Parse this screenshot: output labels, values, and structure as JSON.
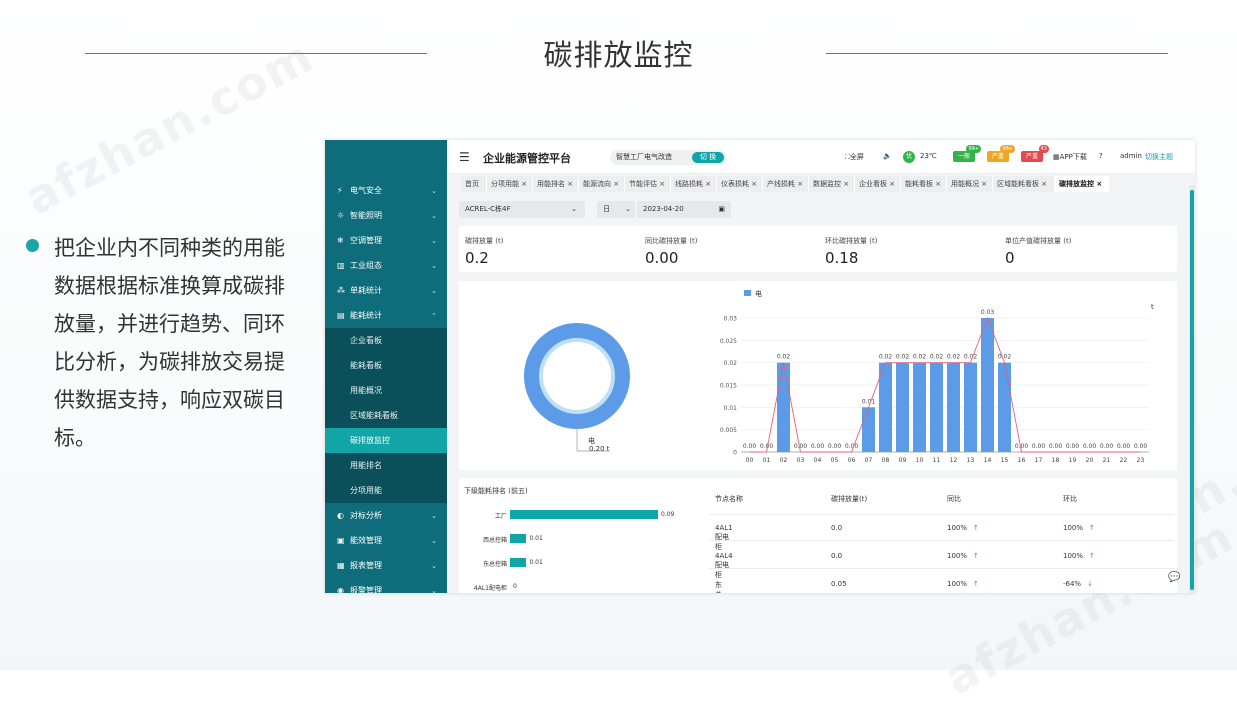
{
  "slide": {
    "title": "碳排放监控",
    "bullet": "把企业内不同种类的用能数据根据标准换算成碳排放量，并进行趋势、同环比分析，为碳排放交易提供数据支持，响应双碳目标。",
    "watermark": "afzhan.com",
    "accent": "#1aa6a6"
  },
  "app": {
    "title": "企业能源管控平台",
    "menu_icon": "hamburger-icon",
    "org_switch": {
      "label": "智慧工厂电气改造",
      "button": "切 换"
    },
    "topbar": {
      "fullscreen": "全屏",
      "weather": "23℃",
      "weather_badge": "优",
      "alert_general": "一般",
      "alert_general_count": "99+",
      "alert_severe": "严重",
      "alert_severe_count": "99+",
      "alert_critical": "严重",
      "alert_critical_count": "43",
      "app_download": "APP下载",
      "user": "admin",
      "theme": "切换主题"
    },
    "sidebar": [
      {
        "label": "电气安全",
        "icon": "lightning-icon",
        "expanded": false
      },
      {
        "label": "智能照明",
        "icon": "light-icon",
        "expanded": false
      },
      {
        "label": "空调管理",
        "icon": "aircon-icon",
        "expanded": false
      },
      {
        "label": "工业组态",
        "icon": "factory-icon",
        "expanded": false
      },
      {
        "label": "单耗统计",
        "icon": "stats-icon",
        "expanded": false
      },
      {
        "label": "能耗统计",
        "icon": "energy-icon",
        "expanded": true
      }
    ],
    "sidebar_sub": [
      "企业看板",
      "能耗看板",
      "用能概况",
      "区域能耗看板",
      "碳排放监控",
      "用能排名",
      "分项用能"
    ],
    "sidebar_sub_active": 4,
    "sidebar_after": [
      {
        "label": "对标分析",
        "icon": "compare-icon"
      },
      {
        "label": "能效管理",
        "icon": "efficiency-icon"
      },
      {
        "label": "报表管理",
        "icon": "report-icon"
      },
      {
        "label": "报警管理",
        "icon": "alarm-icon"
      }
    ],
    "tabs": [
      "首页",
      "分项用能",
      "用能排名",
      "能源流向",
      "节能评估",
      "线路损耗",
      "仪表损耗",
      "产线损耗",
      "数据监控",
      "企业看板",
      "能耗看板",
      "用能概况",
      "区域能耗看板",
      "碳排放监控"
    ],
    "tab_active": 13,
    "filters": {
      "building": "ACREL-C栋4F",
      "period": "日",
      "date": "2023-04-20"
    },
    "kpis": [
      {
        "label": "碳排放量 (t)",
        "value": "0.2"
      },
      {
        "label": "同比碳排放量 (t)",
        "value": "0.00"
      },
      {
        "label": "环比碳排放量 (t)",
        "value": "0.18"
      },
      {
        "label": "单位产值碳排放量 (t)",
        "value": "0"
      }
    ],
    "donut": {
      "label": "电",
      "value": "0.20 t",
      "color": "#5b9be8"
    },
    "ranking": {
      "title": "下级能耗排名 (前五)",
      "items": [
        {
          "name": "工厂",
          "value": 0.09,
          "label": "0.09"
        },
        {
          "name": "西总控箱",
          "value": 0.01,
          "label": "0.01"
        },
        {
          "name": "东总控箱",
          "value": 0.01,
          "label": "0.01"
        },
        {
          "name": "4AL1配电柜",
          "value": 0,
          "label": "0"
        }
      ]
    },
    "table": {
      "headers": [
        "节点名称",
        "碳排放量(t)",
        "同比",
        "环比"
      ],
      "rows": [
        {
          "name": "4AL1配电柜",
          "value": "0.0",
          "yoy": "100%",
          "yoy_dir": "up",
          "mom": "100%",
          "mom_dir": "up"
        },
        {
          "name": "4AL4配电柜",
          "value": "0.0",
          "yoy": "100%",
          "yoy_dir": "up",
          "mom": "100%",
          "mom_dir": "up"
        },
        {
          "name": "东总控箱",
          "value": "0.05",
          "yoy": "100%",
          "yoy_dir": "up",
          "mom": "-64%",
          "mom_dir": "down"
        }
      ]
    }
  },
  "chart_data": {
    "type": "bar",
    "title": "",
    "legend": [
      "电"
    ],
    "legend_position": "top-left",
    "ylabel": "t",
    "ylim": [
      0,
      0.03
    ],
    "yticks": [
      "0",
      "0.005",
      "0.01",
      "0.015",
      "0.02",
      "0.025",
      "0.03"
    ],
    "categories": [
      "00",
      "01",
      "02",
      "03",
      "04",
      "05",
      "06",
      "07",
      "08",
      "09",
      "10",
      "11",
      "12",
      "13",
      "14",
      "15",
      "16",
      "17",
      "18",
      "19",
      "20",
      "21",
      "22",
      "23"
    ],
    "series": [
      {
        "name": "电",
        "color": "#5b9be8",
        "values": [
          0,
          0,
          0.02,
          0,
          0,
          0,
          0,
          0.01,
          0.02,
          0.02,
          0.02,
          0.02,
          0.02,
          0.02,
          0.03,
          0.02,
          0,
          0,
          0,
          0,
          0,
          0,
          0,
          0
        ],
        "labels": [
          "0.00",
          "0.00",
          "0.02",
          "0.00",
          "0.00",
          "0.00",
          "0.00",
          "0.01",
          "0.02",
          "0.02",
          "0.02",
          "0.02",
          "0.02",
          "0.02",
          "0.03",
          "0.02",
          "0.00",
          "0.00",
          "0.00",
          "0.00",
          "0.00",
          "0.00",
          "0.00",
          "0.00"
        ]
      }
    ],
    "trend_line_color": "#e0607e",
    "grid": true
  }
}
